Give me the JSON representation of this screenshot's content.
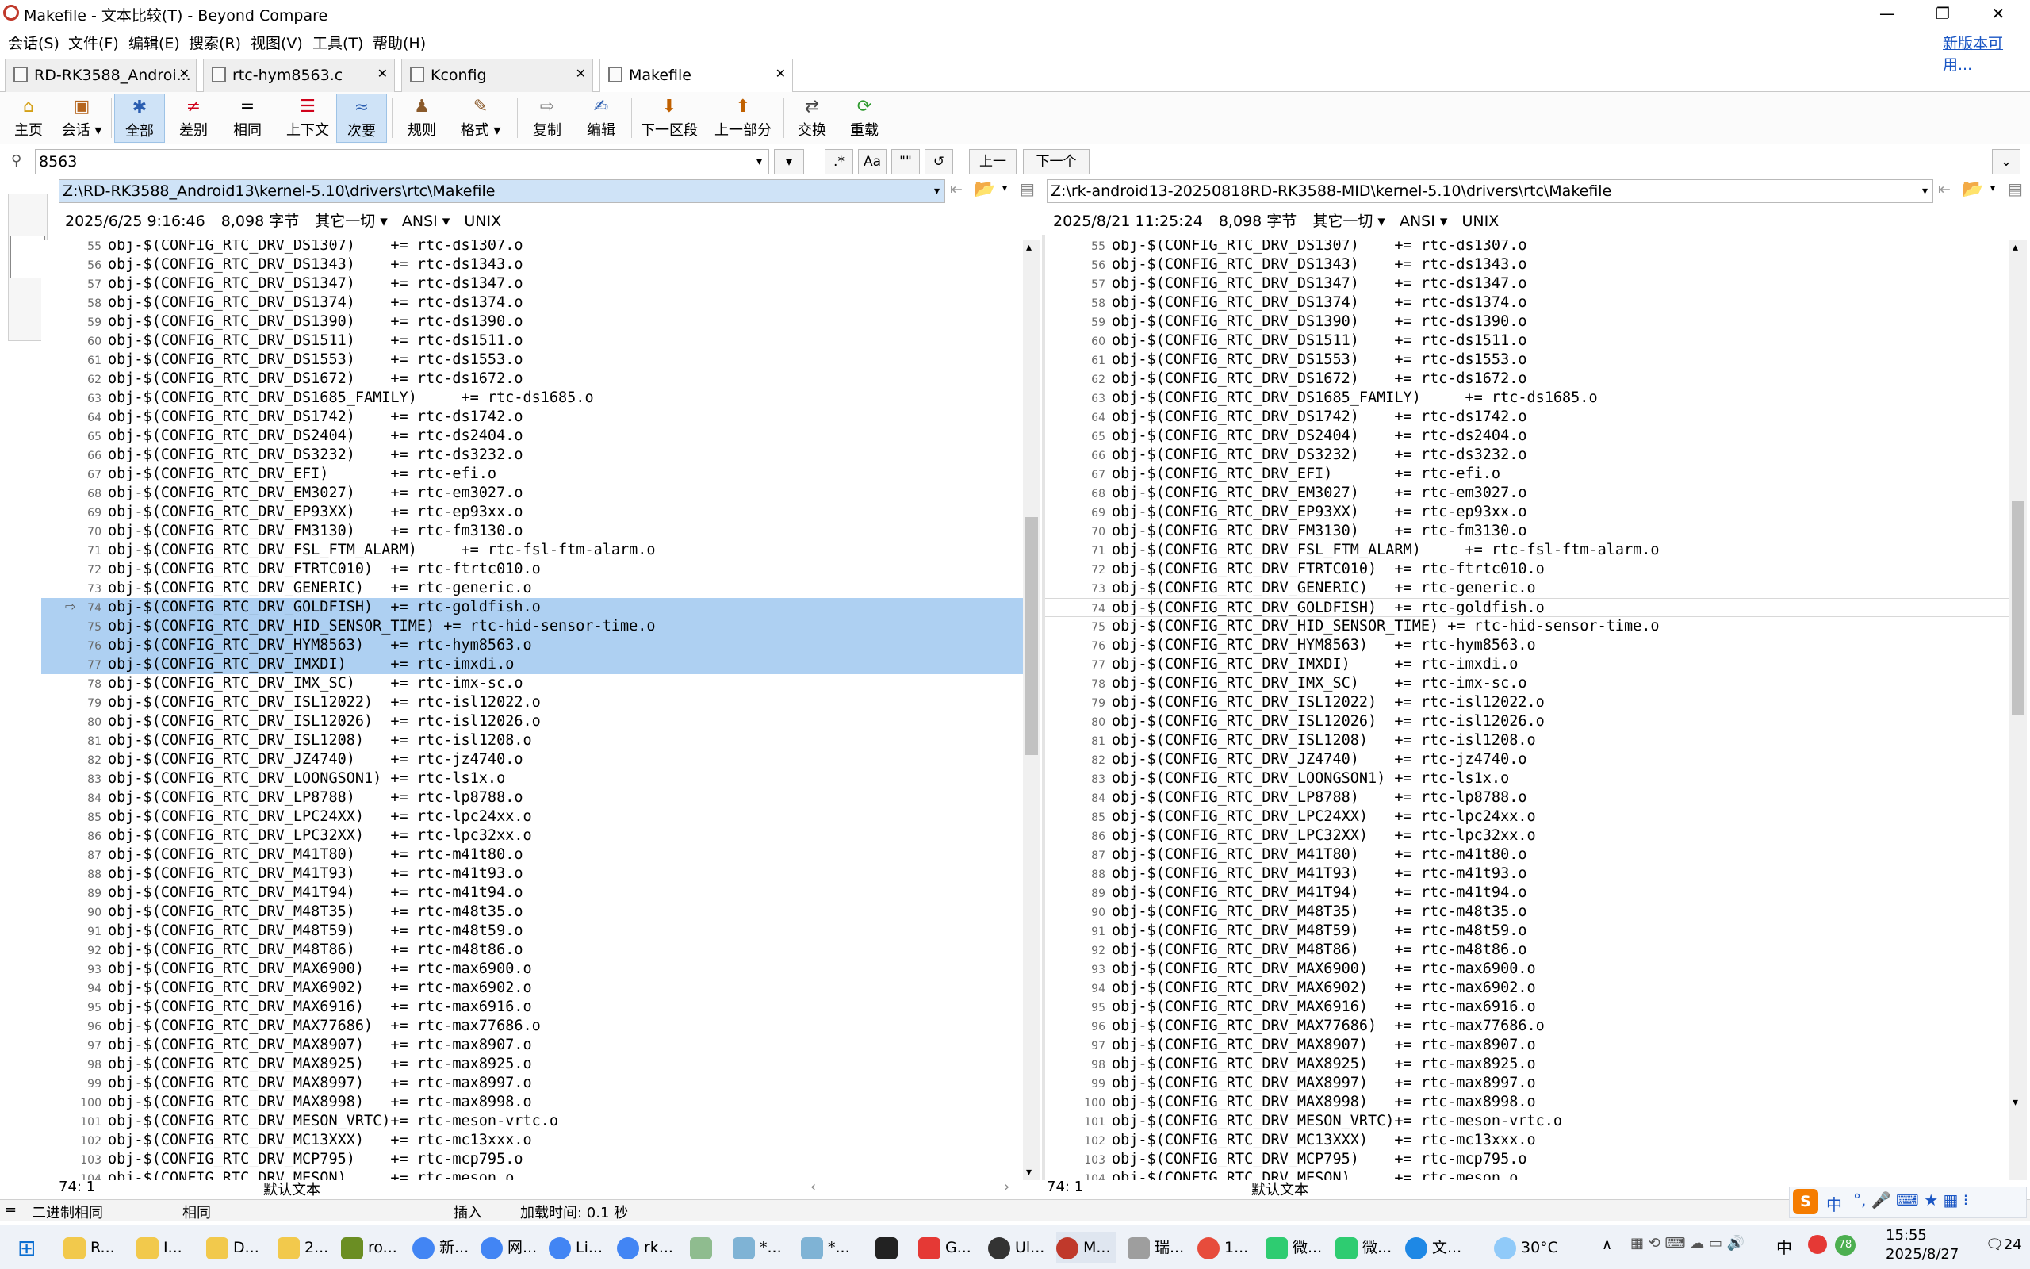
{
  "window": {
    "title": "Makefile - 文本比较(T) - Beyond Compare",
    "min": "—",
    "max": "❐",
    "close": "✕"
  },
  "menu": [
    "会话(S)",
    "文件(F)",
    "编辑(E)",
    "搜索(R)",
    "视图(V)",
    "工具(T)",
    "帮助(H)"
  ],
  "menu_right": "新版本可用...",
  "tabs": [
    "RD-RK3588_Androi...",
    "rtc-hym8563.c",
    "Kconfig",
    "Makefile"
  ],
  "toolbar": {
    "home": "主页",
    "session": "会话",
    "all": "全部",
    "diffs": "差别",
    "same": "相同",
    "context": "上下文",
    "minor": "次要",
    "rules": "规则",
    "format": "格式",
    "copy": "复制",
    "edit": "编辑",
    "next_section": "下一区段",
    "prev_section": "上一部分",
    "swap": "交换",
    "reload": "重载"
  },
  "search": {
    "value": "8563",
    "btn_regex": ".*",
    "btn_case": "Aa",
    "btn_word": "\"\"",
    "btn_refresh": "↺",
    "prev": "上一",
    "next": "下一个"
  },
  "left": {
    "path": "Z:\\RD-RK3588_Android13\\kernel-5.10\\drivers\\rtc\\Makefile",
    "date": "2025/6/25 9:16:46",
    "size": "8,098 字节",
    "other": "其它一切",
    "enc": "ANSI",
    "eol": "UNIX",
    "pos": "74: 1",
    "fmt": "默认文本"
  },
  "right": {
    "path": "Z:\\rk-android13-20250818RD-RK3588-MID\\kernel-5.10\\drivers\\rtc\\Makefile",
    "date": "2025/8/21 11:25:24",
    "size": "8,098 字节",
    "other": "其它一切",
    "enc": "ANSI",
    "eol": "UNIX",
    "pos": "74: 1",
    "fmt": "默认文本"
  },
  "lines": [
    {
      "n": "55",
      "t": "obj-$(CONFIG_RTC_DRV_DS1307)    += rtc-ds1307.o"
    },
    {
      "n": "56",
      "t": "obj-$(CONFIG_RTC_DRV_DS1343)    += rtc-ds1343.o"
    },
    {
      "n": "57",
      "t": "obj-$(CONFIG_RTC_DRV_DS1347)    += rtc-ds1347.o"
    },
    {
      "n": "58",
      "t": "obj-$(CONFIG_RTC_DRV_DS1374)    += rtc-ds1374.o"
    },
    {
      "n": "59",
      "t": "obj-$(CONFIG_RTC_DRV_DS1390)    += rtc-ds1390.o"
    },
    {
      "n": "60",
      "t": "obj-$(CONFIG_RTC_DRV_DS1511)    += rtc-ds1511.o"
    },
    {
      "n": "61",
      "t": "obj-$(CONFIG_RTC_DRV_DS1553)    += rtc-ds1553.o"
    },
    {
      "n": "62",
      "t": "obj-$(CONFIG_RTC_DRV_DS1672)    += rtc-ds1672.o"
    },
    {
      "n": "63",
      "t": "obj-$(CONFIG_RTC_DRV_DS1685_FAMILY)     += rtc-ds1685.o"
    },
    {
      "n": "64",
      "t": "obj-$(CONFIG_RTC_DRV_DS1742)    += rtc-ds1742.o"
    },
    {
      "n": "65",
      "t": "obj-$(CONFIG_RTC_DRV_DS2404)    += rtc-ds2404.o"
    },
    {
      "n": "66",
      "t": "obj-$(CONFIG_RTC_DRV_DS3232)    += rtc-ds3232.o"
    },
    {
      "n": "67",
      "t": "obj-$(CONFIG_RTC_DRV_EFI)       += rtc-efi.o"
    },
    {
      "n": "68",
      "t": "obj-$(CONFIG_RTC_DRV_EM3027)    += rtc-em3027.o"
    },
    {
      "n": "69",
      "t": "obj-$(CONFIG_RTC_DRV_EP93XX)    += rtc-ep93xx.o"
    },
    {
      "n": "70",
      "t": "obj-$(CONFIG_RTC_DRV_FM3130)    += rtc-fm3130.o"
    },
    {
      "n": "71",
      "t": "obj-$(CONFIG_RTC_DRV_FSL_FTM_ALARM)     += rtc-fsl-ftm-alarm.o"
    },
    {
      "n": "72",
      "t": "obj-$(CONFIG_RTC_DRV_FTRTC010)  += rtc-ftrtc010.o"
    },
    {
      "n": "73",
      "t": "obj-$(CONFIG_RTC_DRV_GENERIC)   += rtc-generic.o"
    },
    {
      "n": "74",
      "t": "obj-$(CONFIG_RTC_DRV_GOLDFISH)  += rtc-goldfish.o"
    },
    {
      "n": "75",
      "t": "obj-$(CONFIG_RTC_DRV_HID_SENSOR_TIME) += rtc-hid-sensor-time.o"
    },
    {
      "n": "76",
      "t": "obj-$(CONFIG_RTC_DRV_HYM8563)   += rtc-hym8563.o"
    },
    {
      "n": "77",
      "t": "obj-$(CONFIG_RTC_DRV_IMXDI)     += rtc-imxdi.o"
    },
    {
      "n": "78",
      "t": "obj-$(CONFIG_RTC_DRV_IMX_SC)    += rtc-imx-sc.o"
    },
    {
      "n": "79",
      "t": "obj-$(CONFIG_RTC_DRV_ISL12022)  += rtc-isl12022.o"
    },
    {
      "n": "80",
      "t": "obj-$(CONFIG_RTC_DRV_ISL12026)  += rtc-isl12026.o"
    },
    {
      "n": "81",
      "t": "obj-$(CONFIG_RTC_DRV_ISL1208)   += rtc-isl1208.o"
    },
    {
      "n": "82",
      "t": "obj-$(CONFIG_RTC_DRV_JZ4740)    += rtc-jz4740.o"
    },
    {
      "n": "83",
      "t": "obj-$(CONFIG_RTC_DRV_LOONGSON1) += rtc-ls1x.o"
    },
    {
      "n": "84",
      "t": "obj-$(CONFIG_RTC_DRV_LP8788)    += rtc-lp8788.o"
    },
    {
      "n": "85",
      "t": "obj-$(CONFIG_RTC_DRV_LPC24XX)   += rtc-lpc24xx.o"
    },
    {
      "n": "86",
      "t": "obj-$(CONFIG_RTC_DRV_LPC32XX)   += rtc-lpc32xx.o"
    },
    {
      "n": "87",
      "t": "obj-$(CONFIG_RTC_DRV_M41T80)    += rtc-m41t80.o"
    },
    {
      "n": "88",
      "t": "obj-$(CONFIG_RTC_DRV_M41T93)    += rtc-m41t93.o"
    },
    {
      "n": "89",
      "t": "obj-$(CONFIG_RTC_DRV_M41T94)    += rtc-m41t94.o"
    },
    {
      "n": "90",
      "t": "obj-$(CONFIG_RTC_DRV_M48T35)    += rtc-m48t35.o"
    },
    {
      "n": "91",
      "t": "obj-$(CONFIG_RTC_DRV_M48T59)    += rtc-m48t59.o"
    },
    {
      "n": "92",
      "t": "obj-$(CONFIG_RTC_DRV_M48T86)    += rtc-m48t86.o"
    },
    {
      "n": "93",
      "t": "obj-$(CONFIG_RTC_DRV_MAX6900)   += rtc-max6900.o"
    },
    {
      "n": "94",
      "t": "obj-$(CONFIG_RTC_DRV_MAX6902)   += rtc-max6902.o"
    },
    {
      "n": "95",
      "t": "obj-$(CONFIG_RTC_DRV_MAX6916)   += rtc-max6916.o"
    },
    {
      "n": "96",
      "t": "obj-$(CONFIG_RTC_DRV_MAX77686)  += rtc-max77686.o"
    },
    {
      "n": "97",
      "t": "obj-$(CONFIG_RTC_DRV_MAX8907)   += rtc-max8907.o"
    },
    {
      "n": "98",
      "t": "obj-$(CONFIG_RTC_DRV_MAX8925)   += rtc-max8925.o"
    },
    {
      "n": "99",
      "t": "obj-$(CONFIG_RTC_DRV_MAX8997)   += rtc-max8997.o"
    },
    {
      "n": "100",
      "t": "obj-$(CONFIG_RTC_DRV_MAX8998)   += rtc-max8998.o"
    },
    {
      "n": "101",
      "t": "obj-$(CONFIG_RTC_DRV_MESON_VRTC)+= rtc-meson-vrtc.o"
    },
    {
      "n": "102",
      "t": "obj-$(CONFIG_RTC_DRV_MC13XXX)   += rtc-mc13xxx.o"
    },
    {
      "n": "103",
      "t": "obj-$(CONFIG_RTC_DRV_MCP795)    += rtc-mcp795.o"
    },
    {
      "n": "104",
      "t": "obj-$(CONFIG_RTC_DRV_MESON)     += rtc-meson.o"
    }
  ],
  "status": {
    "mode": "二进制相同",
    "same": "相同",
    "ins": "插入",
    "load": "加载时间: 0.1 秒"
  },
  "taskbar": {
    "apps": [
      "R...",
      "I...",
      "D...",
      "2...",
      "ro...",
      "新...",
      "网...",
      "Li...",
      "rk...",
      "*...",
      "*...",
      "G...",
      "Ul...",
      "M...",
      "瑞...",
      "1...",
      "微...",
      "微...",
      "文..."
    ],
    "ime": "中",
    "weather": "30°C",
    "time": "15:55",
    "date": "2025/8/27",
    "notif": "24",
    "badge": "78",
    "colors": {
      "accent": "#0078d4",
      "highlight": "#aed0f2"
    }
  }
}
